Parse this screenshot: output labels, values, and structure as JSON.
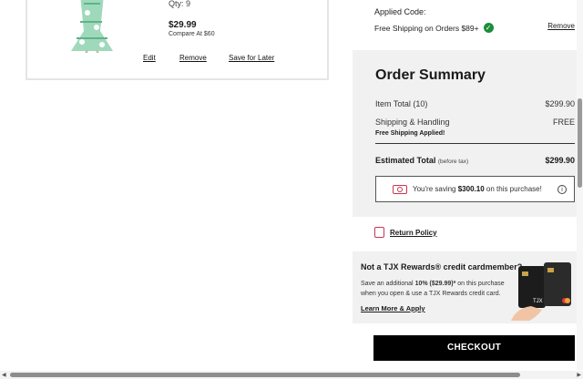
{
  "cart_item": {
    "qty": "Qty: 9",
    "price": "$29.99",
    "compare": "Compare At $60",
    "edit_label": "Edit",
    "remove_label": "Remove",
    "save_later_label": "Save for Later"
  },
  "promo_code": {
    "applied_label": "Applied Code:",
    "code_text": "Free Shipping on Orders $89+",
    "remove_label": "Remove"
  },
  "summary": {
    "title": "Order Summary",
    "item_total_label": "Item Total (10)",
    "item_total_value": "$299.90",
    "shipping_label": "Shipping & Handling",
    "shipping_value": "FREE",
    "free_shipping_applied": "Free Shipping Applied!",
    "estimated_label": "Estimated Total",
    "estimated_note": "(before tax)",
    "estimated_value": "$299.90",
    "saving_prefix": "You're saving",
    "saving_amount": "$300.10",
    "saving_suffix": "on this purchase!"
  },
  "return_policy_label": "Return Policy",
  "rewards": {
    "title": "Not a TJX Rewards® credit cardmember?",
    "text_prefix": "Save an additional",
    "text_bold": "10% ($29.99)*",
    "text_suffix": "on this purchase when you open & use a TJX Rewards credit card.",
    "link_label": "Learn More & Apply",
    "card_brand": "TJX"
  },
  "checkout_label": "CHECKOUT",
  "colors": {
    "success_green": "#1b8e3a",
    "accent_red": "#c8374f",
    "summary_bg": "#f1f1f1"
  }
}
